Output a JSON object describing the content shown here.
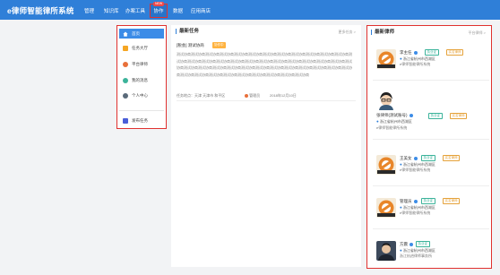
{
  "header": {
    "brand": "e律师智能律所系统",
    "nav": [
      "管理",
      "知识库",
      "办案工具",
      "协作",
      "数据",
      "应用商店"
    ],
    "active_index": 3,
    "badge": "NEW"
  },
  "sidebar": {
    "items": [
      {
        "label": "首页",
        "icon": "home-icon",
        "color": "#ffffff"
      },
      {
        "label": "任务大厅",
        "icon": "task-hall-icon",
        "color": "#f5a623"
      },
      {
        "label": "平台律师",
        "icon": "lawyer-icon",
        "color": "#e8703a"
      },
      {
        "label": "我的消息",
        "icon": "message-icon",
        "color": "#3bb39a"
      },
      {
        "label": "个人中心",
        "icon": "user-icon",
        "color": "#5a6a7a"
      },
      {
        "label": "发布任务",
        "icon": "publish-icon",
        "color": "#4a5ed8"
      }
    ],
    "active_index": 0
  },
  "tasks": {
    "title": "最新任务",
    "more": "更多任务 >",
    "item": {
      "title": "[税会] 测试协商",
      "tag": "协作中",
      "body": "测试协商测试协商测试协商测试协商测试协商测试协商测试协商测试协商测试协商测试协商测试协商测试协商测试协商测试协商测试协商测试协商测试协商测试协商测试协商测试协商测试协商测试协商测试协商测试协商测试协商测试协商测试协商测试协商测试协商测试协商测试协商测试协商测试协商测试协商测试协商测试协商测试协商测试协商测试协商测试协商测试协商测试协商测试协商测试协商测试协商测试协商",
      "location": "任务地点：天津 天津市 和平区",
      "author": "管理员",
      "date": "2018年12月10日"
    }
  },
  "lawyers": {
    "title": "最新律师",
    "more": "平台律师 >",
    "items": [
      {
        "name": "李主任",
        "tag_a": "执业证",
        "tag_b": "实名律师",
        "location": "浙江省杭州市西湖区",
        "firm": "e律师智能律所系统"
      },
      {
        "name": "张律师(测试账号)",
        "tag_a": "执业证",
        "tag_b": "实名律师",
        "location": "浙江省杭州市西湖区",
        "firm": "e律师智能律所系统"
      },
      {
        "name": "王美女",
        "tag_a": "执业证",
        "tag_b": "实名律师",
        "location": "浙江省杭州市西湖区",
        "firm": "e律师智能律所系统"
      },
      {
        "name": "管理员",
        "tag_a": "执业证",
        "tag_b": "实名律师",
        "location": "浙江省杭州市西湖区",
        "firm": "e律师智能律所系统"
      },
      {
        "name": "方震",
        "tag_a": "执业证",
        "tag_b": "",
        "location": "浙江省杭州市西湖区",
        "firm": "浙江杭逍律师事务所"
      }
    ]
  },
  "colors": {
    "primary": "#2f7fd8",
    "highlight": "#e0312f"
  }
}
